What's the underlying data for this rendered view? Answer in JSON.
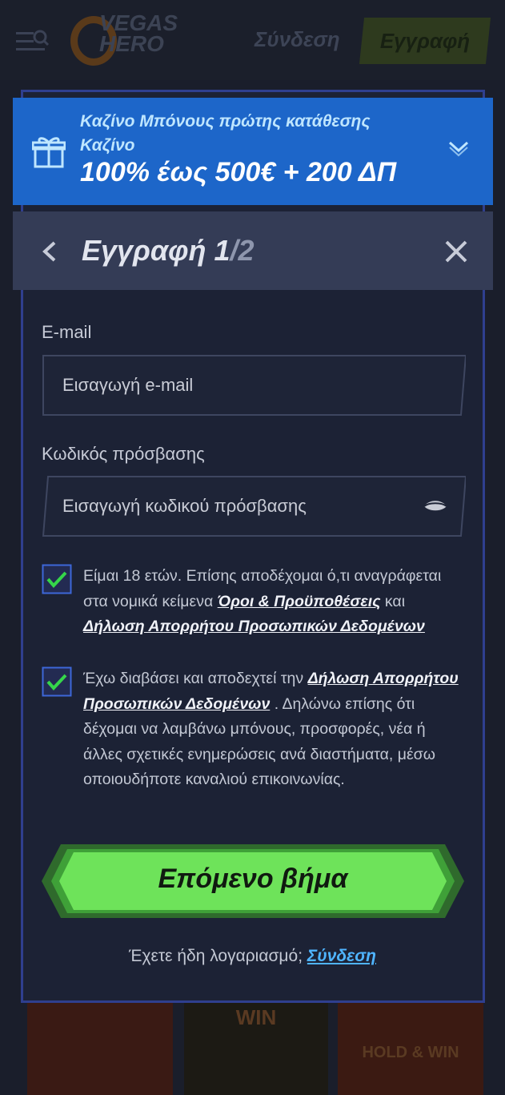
{
  "header": {
    "logo_text_1": "VEGAS",
    "logo_text_2": "HERO",
    "login_label": "Σύνδεση",
    "register_label": "Εγγραφή"
  },
  "bonus": {
    "line1": "Καζίνο Μπόνους πρώτης κατάθεσης",
    "line2": "Καζίνο",
    "offer": "100% έως 500€ + 200 ΔΠ",
    "icon": "gift-icon"
  },
  "dialog": {
    "title": "Εγγραφή",
    "step_current": "1",
    "step_total": "/2"
  },
  "form": {
    "email": {
      "label": "E-mail",
      "placeholder": "Εισαγωγή e-mail",
      "value": ""
    },
    "password": {
      "label": "Κωδικός πρόσβασης",
      "placeholder": "Εισαγωγή κωδικού πρόσβασης",
      "value": ""
    },
    "consent_age": {
      "checked": true,
      "text_before": "Είμαι 18 ετών. Επίσης αποδέχομαι ό,τι αναγράφεται στα νομικά κείμενα ",
      "link_terms": "Όροι & Προϋποθέσεις",
      "text_middle": " και ",
      "link_privacy": "Δήλωση Απορρήτου Προσωπικών Δεδομένων"
    },
    "consent_marketing": {
      "checked": true,
      "text_before": "Έχω διαβάσει και αποδεχτεί την ",
      "link_privacy": "Δήλωση Απορρήτου Προσωπικών Δεδομένων",
      "text_after": " . Δηλώνω επίσης ότι δέχομαι να λαμβάνω μπόνους, προσφορές, νέα ή άλλες σχετικές ενημερώσεις ανά διαστήματα, μέσω οποιουδήποτε καναλιού επικοινωνίας."
    },
    "next_label": "Επόμενο βήμα",
    "have_account": "Έχετε ήδη λογαριασμό; ",
    "login_link": "Σύνδεση"
  },
  "background_games": [
    "",
    "WIN",
    "HOLD & WIN"
  ],
  "colors": {
    "accent_blue": "#1d66c9",
    "cta_green": "#6ee35a",
    "link_blue": "#4fb4ff",
    "check_green": "#35d64a"
  }
}
